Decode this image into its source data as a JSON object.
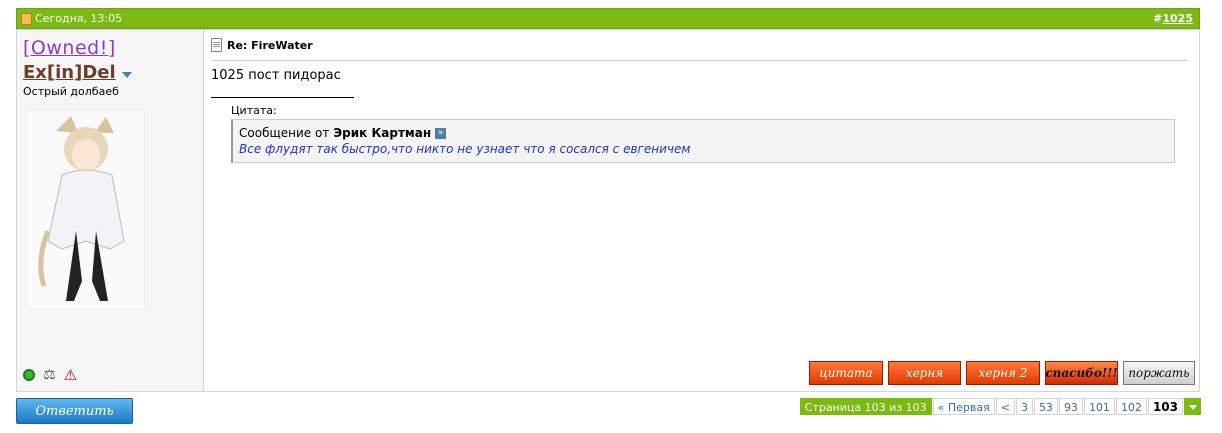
{
  "post": {
    "date": "Сегодня, 13:05",
    "number_prefix": "#",
    "number": "1025"
  },
  "user": {
    "title": "[Owned!]",
    "name": "Ex[in]Del",
    "rank": "Острый долбаеб"
  },
  "message": {
    "title": "Re: FireWater",
    "text": "1025 пост пидорас",
    "quote_label": "Цитата:",
    "quote_from_prefix": "Сообщение от",
    "quote_author": "Эрик Картман",
    "quote_text": "Все флудят так быстро,что никто не узнает что я сосался с евгеничем"
  },
  "actions": {
    "quote": "цитата",
    "herny1": "херня",
    "herny2": "херня 2",
    "thanks": "спасибо!!!",
    "laugh": "поржать"
  },
  "reply_label": "Ответить",
  "pager": {
    "label": "Страница 103 из 103",
    "first": "« Первая",
    "prev": "<",
    "pages": [
      "3",
      "53",
      "93",
      "101",
      "102"
    ],
    "current": "103"
  },
  "colors": {
    "header_green": "#7cb913",
    "quote_blue": "#2233cc",
    "title_purple": "#8a3ec2"
  }
}
